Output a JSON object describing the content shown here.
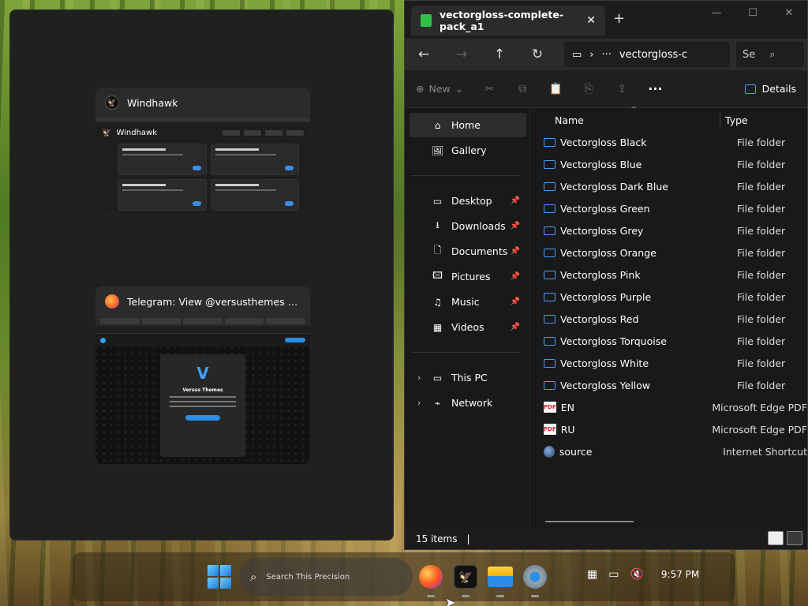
{
  "switcher": {
    "windows": [
      {
        "title": "Windhawk",
        "icon": "windhawk-icon",
        "app_heading": "Windhawk"
      },
      {
        "title": "Telegram: View @versusthemes — Mozi...",
        "icon": "firefox-icon",
        "channel_name": "Versus Themes"
      }
    ]
  },
  "explorer": {
    "tab_title": "vectorgloss-complete-pack_a1",
    "address_tail": "vectorgloss-c",
    "search_placeholder": "Se",
    "new_label": "New",
    "details_label": "Details",
    "columns": {
      "name": "Name",
      "type": "Type"
    },
    "sidebar": {
      "home": "Home",
      "gallery": "Gallery",
      "desktop": "Desktop",
      "downloads": "Downloads",
      "documents": "Documents",
      "pictures": "Pictures",
      "music": "Music",
      "videos": "Videos",
      "this_pc": "This PC",
      "network": "Network"
    },
    "files": [
      {
        "name": "Vectorgloss Black",
        "type": "File folder",
        "kind": "folder"
      },
      {
        "name": "Vectorgloss Blue",
        "type": "File folder",
        "kind": "folder"
      },
      {
        "name": "Vectorgloss Dark Blue",
        "type": "File folder",
        "kind": "folder"
      },
      {
        "name": "Vectorgloss Green",
        "type": "File folder",
        "kind": "folder"
      },
      {
        "name": "Vectorgloss Grey",
        "type": "File folder",
        "kind": "folder"
      },
      {
        "name": "Vectorgloss Orange",
        "type": "File folder",
        "kind": "folder"
      },
      {
        "name": "Vectorgloss Pink",
        "type": "File folder",
        "kind": "folder"
      },
      {
        "name": "Vectorgloss Purple",
        "type": "File folder",
        "kind": "folder"
      },
      {
        "name": "Vectorgloss Red",
        "type": "File folder",
        "kind": "folder"
      },
      {
        "name": "Vectorgloss Torquoise",
        "type": "File folder",
        "kind": "folder"
      },
      {
        "name": "Vectorgloss White",
        "type": "File folder",
        "kind": "folder"
      },
      {
        "name": "Vectorgloss Yellow",
        "type": "File folder",
        "kind": "folder"
      },
      {
        "name": "EN",
        "type": "Microsoft Edge PDF",
        "kind": "pdf"
      },
      {
        "name": "RU",
        "type": "Microsoft Edge PDF",
        "kind": "pdf"
      },
      {
        "name": "source",
        "type": "Internet Shortcut",
        "kind": "web"
      }
    ],
    "status": "15 items"
  },
  "taskbar": {
    "search_placeholder": "Search This Precision",
    "clock": "9:57 PM",
    "apps": [
      "firefox-icon",
      "windhawk-icon",
      "file-explorer-icon",
      "settings-icon"
    ]
  },
  "colors": {
    "accent": "#4a9cff",
    "window_bg": "#191919",
    "tab_icon": "#2ec04b"
  }
}
